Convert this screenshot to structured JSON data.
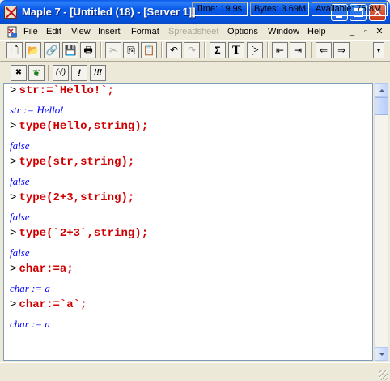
{
  "window": {
    "title": "Maple 7  - [Untitled (18) - [Server 1]]",
    "close_glyph": "✕",
    "icon": "maple-app-icon"
  },
  "menu": {
    "items": [
      "File",
      "Edit",
      "View",
      "Insert",
      "Format",
      "Spreadsheet",
      "Options",
      "Window",
      "Help"
    ],
    "disabled": [
      "Spreadsheet"
    ],
    "mdi_buttons": [
      "_",
      "▫",
      "✕"
    ]
  },
  "toolbar1": {
    "buttons": [
      {
        "icon": "new-document-icon",
        "glyph": "🗋"
      },
      {
        "icon": "open-folder-icon",
        "glyph": "📂"
      },
      {
        "icon": "open-url-icon",
        "glyph": "🔗"
      },
      {
        "icon": "save-icon",
        "glyph": "💾"
      },
      {
        "icon": "print-icon",
        "glyph": "🖶"
      },
      {
        "icon": "cut-icon",
        "glyph": "✂"
      },
      {
        "icon": "copy-icon",
        "glyph": "⎘"
      },
      {
        "icon": "paste-icon",
        "glyph": "📋"
      },
      {
        "icon": "undo-icon",
        "glyph": "↶"
      },
      {
        "icon": "redo-icon",
        "glyph": "↷"
      },
      {
        "icon": "insert-math-icon",
        "glyph": "Σ"
      },
      {
        "icon": "insert-text-icon",
        "glyph": "T"
      },
      {
        "icon": "insert-prompt-icon",
        "glyph": "[>"
      },
      {
        "icon": "outdent-icon",
        "glyph": "⇤"
      },
      {
        "icon": "indent-icon",
        "glyph": "⇥"
      },
      {
        "icon": "back-icon",
        "glyph": "⇐"
      },
      {
        "icon": "forward-icon",
        "glyph": "⇒"
      }
    ]
  },
  "toolbar2": {
    "buttons": [
      {
        "icon": "stop-icon",
        "glyph": "✖"
      },
      {
        "icon": "maple-leaf-icon",
        "glyph": "❦"
      },
      {
        "icon": "sqrt-toggle-icon",
        "glyph": "(√)"
      },
      {
        "icon": "execute-icon",
        "glyph": "!"
      },
      {
        "icon": "execute-all-icon",
        "glyph": "!!!"
      }
    ]
  },
  "worksheet": {
    "prompt_symbol": ">",
    "lines": [
      {
        "kind": "input",
        "text": "str:=`Hello!`;"
      },
      {
        "kind": "output",
        "text": "str := Hello!"
      },
      {
        "kind": "input",
        "text": "type(Hello,string);"
      },
      {
        "kind": "output",
        "text": "false"
      },
      {
        "kind": "input",
        "text": "type(str,string);"
      },
      {
        "kind": "output",
        "text": "false"
      },
      {
        "kind": "input",
        "text": "type(2+3,string);"
      },
      {
        "kind": "output",
        "text": "false"
      },
      {
        "kind": "input",
        "text": "type(`2+3`,string);"
      },
      {
        "kind": "output",
        "text": "false"
      },
      {
        "kind": "input",
        "text": "char:=a;"
      },
      {
        "kind": "output",
        "text": "char := a"
      },
      {
        "kind": "input",
        "text": "char:=`a`;"
      },
      {
        "kind": "output",
        "text": "char := a"
      }
    ]
  },
  "status": {
    "time": "Time: 19.9s",
    "bytes": "Bytes: 3.69M",
    "available": "Available: 75.8M"
  },
  "colors": {
    "input_red": "#d00000",
    "output_blue": "#0000ff",
    "titlebar_blue": "#0858e8"
  }
}
